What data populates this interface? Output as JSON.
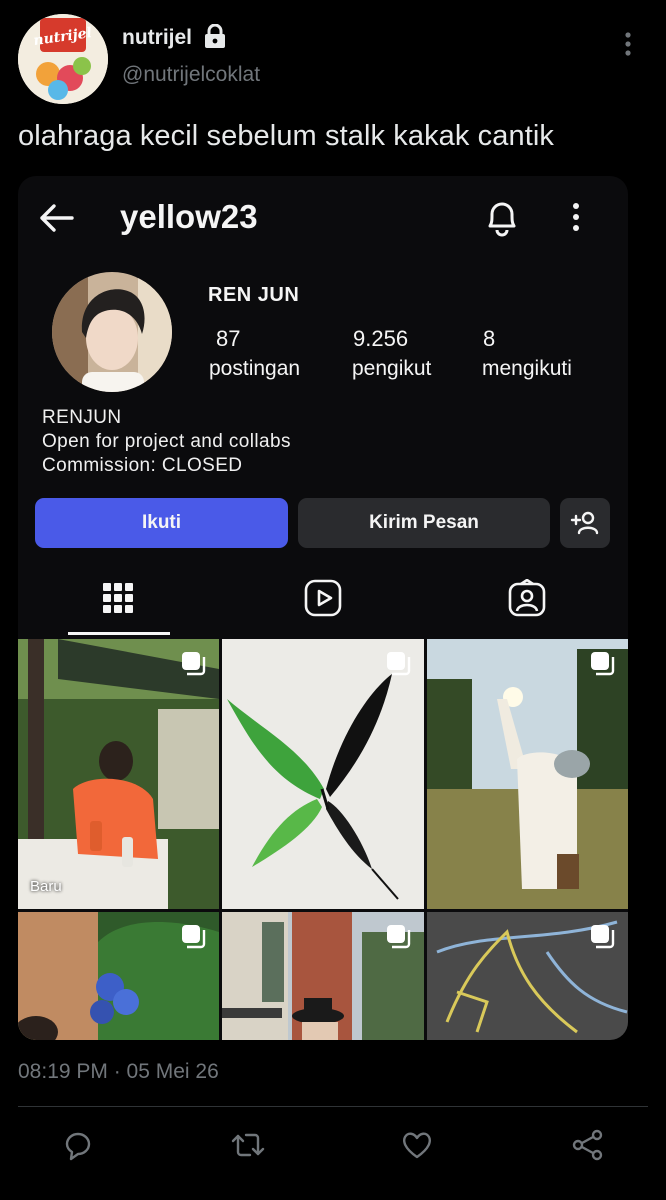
{
  "tweet": {
    "display_name": "nutrijel",
    "handle": "@nutrijelcoklat",
    "avatar_logo_text": "nutrijel",
    "text": "olahraga kecil sebelum stalk kakak cantik",
    "timestamp": "08:19 PM · 05 Mei 26",
    "icons": [
      "lock-icon",
      "more-vertical-icon",
      "reply-icon",
      "retweet-icon",
      "like-icon",
      "share-icon"
    ]
  },
  "instagram": {
    "username": "yellow23",
    "full_name": "REN JUN",
    "stats": [
      {
        "value": "87",
        "label": "postingan"
      },
      {
        "value": "9.256",
        "label": "pengikut"
      },
      {
        "value": "8",
        "label": "mengikuti"
      }
    ],
    "bio": [
      "RENJUN",
      "Open for project and collabs",
      "Commission: CLOSED"
    ],
    "buttons": {
      "follow": "Ikuti",
      "message": "Kirim Pesan"
    },
    "tabs": [
      "grid-icon",
      "reels-icon",
      "tagged-icon"
    ],
    "grid_badge_new": "Baru",
    "colors": {
      "follow_button": "#4a5ae8",
      "secondary_button": "#2a2b2e",
      "card_bg": "#0b0b0d"
    }
  }
}
